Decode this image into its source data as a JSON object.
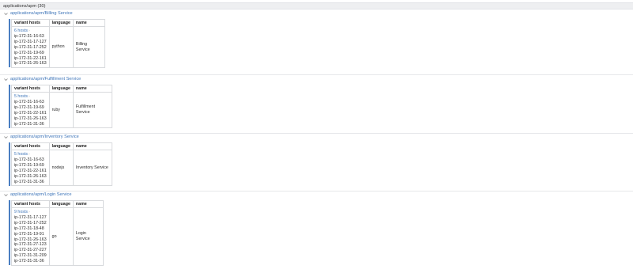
{
  "header": {
    "title": "applications/apm (30)"
  },
  "columns": {
    "hosts": "variant hosts",
    "language": "language",
    "name": "name"
  },
  "colors": {
    "link": "#3d74b8",
    "accent_bar": "#4a7ec2",
    "header_bg": "#eeeff1"
  },
  "icons": {
    "expand": "chevron-down-icon",
    "hosts_caret": "chevron-right-icon"
  },
  "sections": [
    {
      "title": "applications/apm/Billing Service",
      "hosts_label": "6 hosts",
      "hosts": [
        "ip-172-31-16-63",
        "ip-172-31-17-127",
        "ip-172-31-17-252",
        "ip-172-31-19-69",
        "ip-172-31-22-161",
        "ip-172-31-26-163"
      ],
      "language": "python",
      "name": "Billing Service"
    },
    {
      "title": "applications/apm/Fulfillment Service",
      "hosts_label": "5 hosts",
      "hosts": [
        "ip-172-31-16-63",
        "ip-172-31-19-69",
        "ip-172-31-22-161",
        "ip-172-31-26-163",
        "ip-172-31-31-36"
      ],
      "language": "ruby",
      "name": "Fulfillment Service"
    },
    {
      "title": "applications/apm/Inventory Service",
      "hosts_label": "5 hosts",
      "hosts": [
        "ip-172-31-16-63",
        "ip-172-31-19-69",
        "ip-172-31-22-161",
        "ip-172-31-26-163",
        "ip-172-31-31-36"
      ],
      "language": "nodejs",
      "name": "Inventory Service"
    },
    {
      "title": "applications/apm/Login Service",
      "hosts_label": "9 hosts",
      "hosts": [
        "ip-172-31-17-127",
        "ip-172-31-17-252",
        "ip-172-31-18-48",
        "ip-172-31-19-91",
        "ip-172-31-26-163",
        "ip-172-31-27-123",
        "ip-172-31-27-227",
        "ip-172-31-31-209",
        "ip-172-31-31-36"
      ],
      "language": "go",
      "name": "Login Service"
    }
  ]
}
